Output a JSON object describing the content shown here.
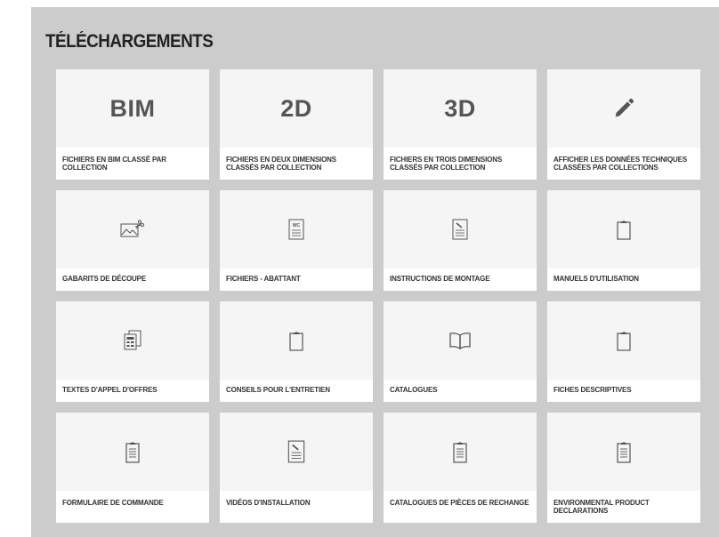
{
  "page": {
    "title": "TÉLÉCHARGEMENTS"
  },
  "cards": [
    {
      "label": "FICHIERS EN BIM CLASSÉ PAR COLLECTION",
      "text_icon": "BIM"
    },
    {
      "label": "FICHIERS EN DEUX DIMENSIONS CLASSÉS PAR COLLECTION",
      "text_icon": "2D"
    },
    {
      "label": "FICHIERS EN TROIS DIMENSIONS CLASSÉS PAR COLLECTION",
      "text_icon": "3D"
    },
    {
      "label": "AFFICHER LES DONNÉES TECHNIQUES CLASSÉES PAR COLLECTIONS",
      "icon": "pencil-icon"
    },
    {
      "label": "GABARITS DE DÉCOUPE",
      "icon": "template-scissors-icon"
    },
    {
      "label": "FICHIERS - ABATTANT",
      "icon": "wc-document-icon"
    },
    {
      "label": "INSTRUCTIONS DE MONTAGE",
      "icon": "instruction-document-icon"
    },
    {
      "label": "MANUELS D'UTILISATION",
      "icon": "clipboard-icon"
    },
    {
      "label": "TEXTES D'APPEL D'OFFRES",
      "icon": "documents-stack-icon"
    },
    {
      "label": "CONSEILS POUR L'ENTRETIEN",
      "icon": "clipboard-icon"
    },
    {
      "label": "CATALOGUES",
      "icon": "open-book-icon"
    },
    {
      "label": "FICHES DESCRIPTIVES",
      "icon": "clipboard-icon"
    },
    {
      "label": "FORMULAIRE DE COMMANDE",
      "icon": "clipboard-list-icon"
    },
    {
      "label": "VIDÉOS D'INSTALLATION",
      "icon": "instruction-document-icon"
    },
    {
      "label": "CATALOGUES DE PIÈCES DE RECHANGE",
      "icon": "clipboard-list-icon"
    },
    {
      "label": "ENVIRONMENTAL PRODUCT DECLARATIONS",
      "icon": "clipboard-list-icon"
    }
  ],
  "colors": {
    "panel_background": "#cccccc",
    "card_background": "#f5f5f5",
    "label_background": "#ffffff",
    "icon_color": "#555555",
    "text_color": "#333333"
  }
}
